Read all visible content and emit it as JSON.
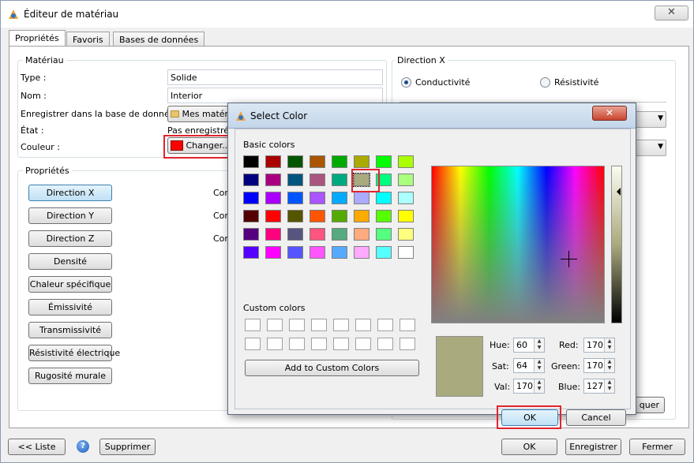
{
  "window": {
    "title": "Éditeur de matériau",
    "close_label": "✕"
  },
  "tabs": [
    {
      "label": "Propriétés"
    },
    {
      "label": "Favoris"
    },
    {
      "label": "Bases de données"
    }
  ],
  "material": {
    "group_label": "Matériau",
    "type_label": "Type :",
    "type_value": "Solide",
    "name_label": "Nom :",
    "name_value": "Interior",
    "save_db_label": "Enregistrer dans la base de données :",
    "save_db_button": "Mes matéri",
    "state_label": "État :",
    "state_value": "Pas enregistrée",
    "color_label": "Couleur :",
    "color_button": "Changer...",
    "current_color": "#ff0000"
  },
  "properties": {
    "group_label": "Propriétés",
    "buttons": [
      "Direction X",
      "Direction Y",
      "Direction Z",
      "Densité",
      "Chaleur spécifique",
      "Émissivité",
      "Transmissivité",
      "Résistivité électrique",
      "Rugosité murale"
    ],
    "side_labels": [
      "Con",
      "Con",
      "Con"
    ]
  },
  "direction": {
    "group_label": "Direction X",
    "option1": "Conductivité",
    "option2": "Résistivité",
    "partial_button": "quer"
  },
  "bottom": {
    "list_button": "<< Liste",
    "help_icon": "?",
    "delete_button": "Supprimer",
    "ok_button": "OK",
    "save_button": "Enregistrer",
    "close_button": "Fermer"
  },
  "dialog": {
    "title": "Select Color",
    "close_label": "✕",
    "basic_colors_label": "Basic colors",
    "basic_colors": [
      [
        "#000000",
        "#aa0000",
        "#005500",
        "#aa5500",
        "#00aa00",
        "#aaaa00",
        "#00ff00",
        "#aaff00"
      ],
      [
        "#00007f",
        "#aa007f",
        "#00557f",
        "#aa557f",
        "#00aa7f",
        "#aaaa7f",
        "#00ff7f",
        "#aaff7f"
      ],
      [
        "#0000ff",
        "#aa00ff",
        "#0055ff",
        "#aa55ff",
        "#00aaff",
        "#aaaaff",
        "#00ffff",
        "#aaffff"
      ],
      [
        "#550000",
        "#ff0000",
        "#555500",
        "#ff5500",
        "#55aa00",
        "#ffaa00",
        "#55ff00",
        "#ffff00"
      ],
      [
        "#55007f",
        "#ff007f",
        "#55557f",
        "#ff557f",
        "#55aa7f",
        "#ffaa7f",
        "#55ff7f",
        "#ffff7f"
      ],
      [
        "#5500ff",
        "#ff00ff",
        "#5555ff",
        "#ff55ff",
        "#55aaff",
        "#ffaaff",
        "#55ffff",
        "#ffffff"
      ]
    ],
    "selected_color": "#aaaa7f",
    "custom_colors_label": "Custom colors",
    "add_custom_button": "Add to Custom Colors",
    "hue_label": "Hue:",
    "hue_value": "60",
    "sat_label": "Sat:",
    "sat_value": "64",
    "val_label": "Val:",
    "val_value": "170",
    "red_label": "Red:",
    "red_value": "170",
    "green_label": "Green:",
    "green_value": "170",
    "blue_label": "Blue:",
    "blue_value": "127",
    "ok_button": "OK",
    "cancel_button": "Cancel"
  }
}
